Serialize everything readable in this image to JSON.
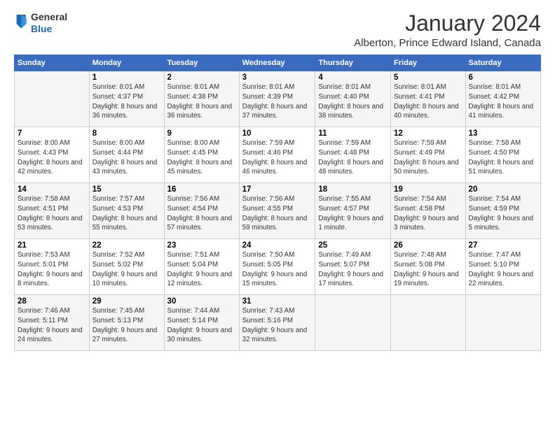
{
  "logo": {
    "general": "General",
    "blue": "Blue"
  },
  "title": "January 2024",
  "subtitle": "Alberton, Prince Edward Island, Canada",
  "days_header": [
    "Sunday",
    "Monday",
    "Tuesday",
    "Wednesday",
    "Thursday",
    "Friday",
    "Saturday"
  ],
  "weeks": [
    [
      {
        "day": "",
        "sunrise": "",
        "sunset": "",
        "daylight": ""
      },
      {
        "day": "1",
        "sunrise": "Sunrise: 8:01 AM",
        "sunset": "Sunset: 4:37 PM",
        "daylight": "Daylight: 8 hours and 36 minutes."
      },
      {
        "day": "2",
        "sunrise": "Sunrise: 8:01 AM",
        "sunset": "Sunset: 4:38 PM",
        "daylight": "Daylight: 8 hours and 36 minutes."
      },
      {
        "day": "3",
        "sunrise": "Sunrise: 8:01 AM",
        "sunset": "Sunset: 4:39 PM",
        "daylight": "Daylight: 8 hours and 37 minutes."
      },
      {
        "day": "4",
        "sunrise": "Sunrise: 8:01 AM",
        "sunset": "Sunset: 4:40 PM",
        "daylight": "Daylight: 8 hours and 38 minutes."
      },
      {
        "day": "5",
        "sunrise": "Sunrise: 8:01 AM",
        "sunset": "Sunset: 4:41 PM",
        "daylight": "Daylight: 8 hours and 40 minutes."
      },
      {
        "day": "6",
        "sunrise": "Sunrise: 8:01 AM",
        "sunset": "Sunset: 4:42 PM",
        "daylight": "Daylight: 8 hours and 41 minutes."
      }
    ],
    [
      {
        "day": "7",
        "sunrise": "Sunrise: 8:00 AM",
        "sunset": "Sunset: 4:43 PM",
        "daylight": "Daylight: 8 hours and 42 minutes."
      },
      {
        "day": "8",
        "sunrise": "Sunrise: 8:00 AM",
        "sunset": "Sunset: 4:44 PM",
        "daylight": "Daylight: 8 hours and 43 minutes."
      },
      {
        "day": "9",
        "sunrise": "Sunrise: 8:00 AM",
        "sunset": "Sunset: 4:45 PM",
        "daylight": "Daylight: 8 hours and 45 minutes."
      },
      {
        "day": "10",
        "sunrise": "Sunrise: 7:59 AM",
        "sunset": "Sunset: 4:46 PM",
        "daylight": "Daylight: 8 hours and 46 minutes."
      },
      {
        "day": "11",
        "sunrise": "Sunrise: 7:59 AM",
        "sunset": "Sunset: 4:48 PM",
        "daylight": "Daylight: 8 hours and 48 minutes."
      },
      {
        "day": "12",
        "sunrise": "Sunrise: 7:59 AM",
        "sunset": "Sunset: 4:49 PM",
        "daylight": "Daylight: 8 hours and 50 minutes."
      },
      {
        "day": "13",
        "sunrise": "Sunrise: 7:58 AM",
        "sunset": "Sunset: 4:50 PM",
        "daylight": "Daylight: 8 hours and 51 minutes."
      }
    ],
    [
      {
        "day": "14",
        "sunrise": "Sunrise: 7:58 AM",
        "sunset": "Sunset: 4:51 PM",
        "daylight": "Daylight: 8 hours and 53 minutes."
      },
      {
        "day": "15",
        "sunrise": "Sunrise: 7:57 AM",
        "sunset": "Sunset: 4:53 PM",
        "daylight": "Daylight: 8 hours and 55 minutes."
      },
      {
        "day": "16",
        "sunrise": "Sunrise: 7:56 AM",
        "sunset": "Sunset: 4:54 PM",
        "daylight": "Daylight: 8 hours and 57 minutes."
      },
      {
        "day": "17",
        "sunrise": "Sunrise: 7:56 AM",
        "sunset": "Sunset: 4:55 PM",
        "daylight": "Daylight: 8 hours and 59 minutes."
      },
      {
        "day": "18",
        "sunrise": "Sunrise: 7:55 AM",
        "sunset": "Sunset: 4:57 PM",
        "daylight": "Daylight: 9 hours and 1 minute."
      },
      {
        "day": "19",
        "sunrise": "Sunrise: 7:54 AM",
        "sunset": "Sunset: 4:58 PM",
        "daylight": "Daylight: 9 hours and 3 minutes."
      },
      {
        "day": "20",
        "sunrise": "Sunrise: 7:54 AM",
        "sunset": "Sunset: 4:59 PM",
        "daylight": "Daylight: 9 hours and 5 minutes."
      }
    ],
    [
      {
        "day": "21",
        "sunrise": "Sunrise: 7:53 AM",
        "sunset": "Sunset: 5:01 PM",
        "daylight": "Daylight: 9 hours and 8 minutes."
      },
      {
        "day": "22",
        "sunrise": "Sunrise: 7:52 AM",
        "sunset": "Sunset: 5:02 PM",
        "daylight": "Daylight: 9 hours and 10 minutes."
      },
      {
        "day": "23",
        "sunrise": "Sunrise: 7:51 AM",
        "sunset": "Sunset: 5:04 PM",
        "daylight": "Daylight: 9 hours and 12 minutes."
      },
      {
        "day": "24",
        "sunrise": "Sunrise: 7:50 AM",
        "sunset": "Sunset: 5:05 PM",
        "daylight": "Daylight: 9 hours and 15 minutes."
      },
      {
        "day": "25",
        "sunrise": "Sunrise: 7:49 AM",
        "sunset": "Sunset: 5:07 PM",
        "daylight": "Daylight: 9 hours and 17 minutes."
      },
      {
        "day": "26",
        "sunrise": "Sunrise: 7:48 AM",
        "sunset": "Sunset: 5:08 PM",
        "daylight": "Daylight: 9 hours and 19 minutes."
      },
      {
        "day": "27",
        "sunrise": "Sunrise: 7:47 AM",
        "sunset": "Sunset: 5:10 PM",
        "daylight": "Daylight: 9 hours and 22 minutes."
      }
    ],
    [
      {
        "day": "28",
        "sunrise": "Sunrise: 7:46 AM",
        "sunset": "Sunset: 5:11 PM",
        "daylight": "Daylight: 9 hours and 24 minutes."
      },
      {
        "day": "29",
        "sunrise": "Sunrise: 7:45 AM",
        "sunset": "Sunset: 5:13 PM",
        "daylight": "Daylight: 9 hours and 27 minutes."
      },
      {
        "day": "30",
        "sunrise": "Sunrise: 7:44 AM",
        "sunset": "Sunset: 5:14 PM",
        "daylight": "Daylight: 9 hours and 30 minutes."
      },
      {
        "day": "31",
        "sunrise": "Sunrise: 7:43 AM",
        "sunset": "Sunset: 5:16 PM",
        "daylight": "Daylight: 9 hours and 32 minutes."
      },
      {
        "day": "",
        "sunrise": "",
        "sunset": "",
        "daylight": ""
      },
      {
        "day": "",
        "sunrise": "",
        "sunset": "",
        "daylight": ""
      },
      {
        "day": "",
        "sunrise": "",
        "sunset": "",
        "daylight": ""
      }
    ]
  ]
}
